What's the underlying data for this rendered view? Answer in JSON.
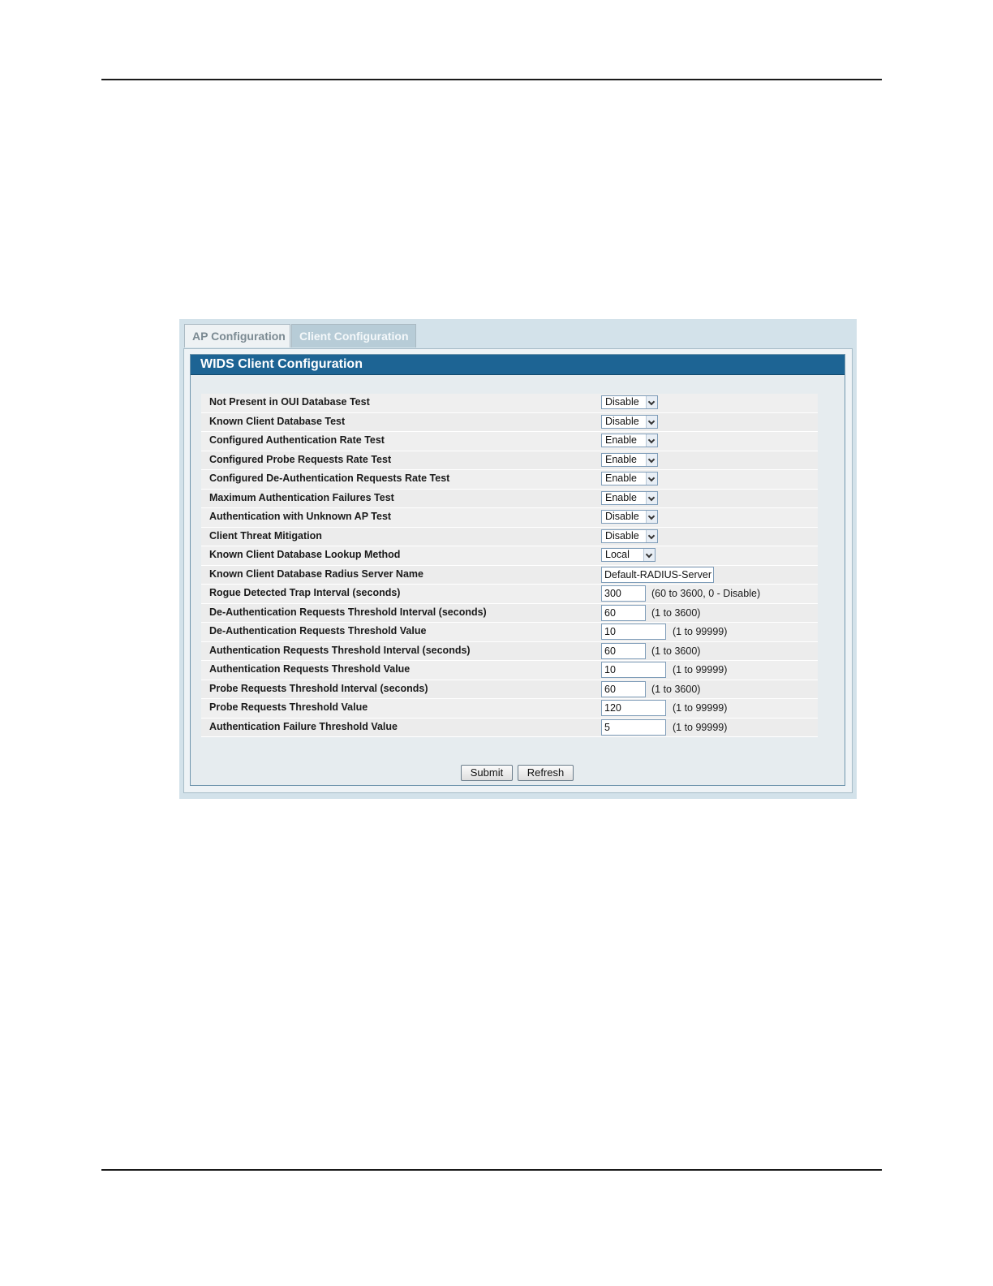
{
  "tabs": [
    {
      "label": "AP Configuration",
      "active": false
    },
    {
      "label": "Client Configuration",
      "active": true
    }
  ],
  "panel": {
    "title": "WIDS Client Configuration"
  },
  "rows": [
    {
      "label": "Not Present in OUI Database Test",
      "type": "select",
      "value": "Disable"
    },
    {
      "label": "Known Client Database Test",
      "type": "select",
      "value": "Disable"
    },
    {
      "label": "Configured Authentication Rate Test",
      "type": "select",
      "value": "Enable"
    },
    {
      "label": "Configured Probe Requests Rate Test",
      "type": "select",
      "value": "Enable"
    },
    {
      "label": "Configured De-Authentication Requests Rate Test",
      "type": "select",
      "value": "Enable"
    },
    {
      "label": "Maximum Authentication Failures Test",
      "type": "select",
      "value": "Enable"
    },
    {
      "label": "Authentication with Unknown AP Test",
      "type": "select",
      "value": "Disable"
    },
    {
      "label": "Client Threat Mitigation",
      "type": "select",
      "value": "Disable"
    },
    {
      "label": "Known Client Database Lookup Method",
      "type": "select",
      "value": "Local"
    },
    {
      "label": "Known Client Database Radius Server Name",
      "type": "text",
      "value": "Default-RADIUS-Server",
      "hint": ""
    },
    {
      "label": "Rogue Detected Trap Interval (seconds)",
      "type": "text",
      "value": "300",
      "hint": "(60 to 3600, 0 - Disable)"
    },
    {
      "label": "De-Authentication Requests Threshold Interval (seconds)",
      "type": "text",
      "value": "60",
      "hint": "(1 to 3600)"
    },
    {
      "label": "De-Authentication Requests Threshold Value",
      "type": "text",
      "value": "10",
      "hint": "(1 to 99999)"
    },
    {
      "label": "Authentication Requests Threshold Interval (seconds)",
      "type": "text",
      "value": "60",
      "hint": "(1 to 3600)"
    },
    {
      "label": "Authentication Requests Threshold Value",
      "type": "text",
      "value": "10",
      "hint": "(1 to 99999)"
    },
    {
      "label": "Probe Requests Threshold Interval (seconds)",
      "type": "text",
      "value": "60",
      "hint": "(1 to 3600)"
    },
    {
      "label": "Probe Requests Threshold Value",
      "type": "text",
      "value": "120",
      "hint": "(1 to 99999)"
    },
    {
      "label": "Authentication Failure Threshold Value",
      "type": "text",
      "value": "5",
      "hint": "(1 to 99999)"
    }
  ],
  "buttons": {
    "submit": "Submit",
    "refresh": "Refresh"
  },
  "colors": {
    "header_bg": "#1d6494",
    "frame_bg": "#d3e2ea",
    "active_tab_bg": "#b7ccd7"
  }
}
